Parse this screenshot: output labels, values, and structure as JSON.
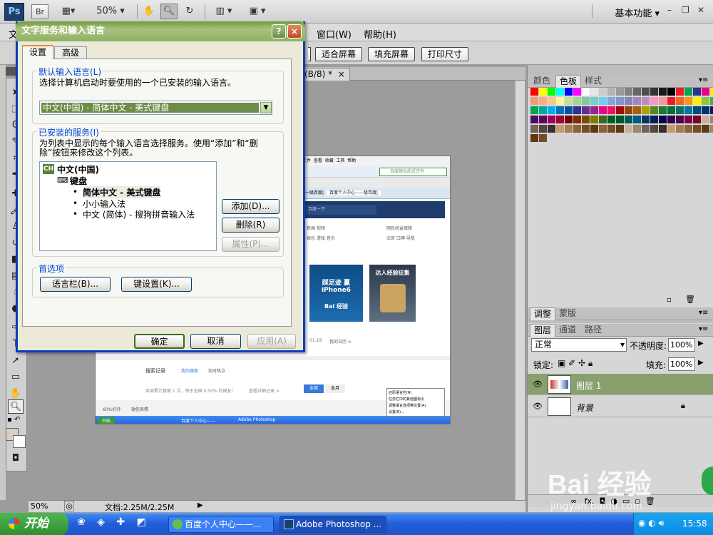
{
  "appbar": {
    "ps_logo": "Ps",
    "br_logo": "Br",
    "zoom": "50%",
    "workspace": "基本功能"
  },
  "menubar": {
    "visible_item_first": "文",
    "items": [
      "窗口(W)",
      "帮助(H)"
    ]
  },
  "options_bar": {
    "buttons": [
      "适合屏幕",
      "填充屏幕",
      "打印尺寸"
    ]
  },
  "document": {
    "tab_label": "(B/8) *",
    "tab_close": "×",
    "zoom": "50%",
    "doc_size": "文档:2.25M/2.25M"
  },
  "right_panel": {
    "color_tabs": [
      "颜色",
      "色板",
      "样式"
    ],
    "adjust_tabs": [
      "调整",
      "蒙版"
    ],
    "layer_tabs": [
      "图层",
      "通道",
      "路径"
    ],
    "blend_mode": "正常",
    "opacity_label": "不透明度:",
    "opacity_value": "100%",
    "lock_label": "锁定:",
    "fill_label": "填充:",
    "fill_value": "100%",
    "layers": [
      {
        "name": "图层 1",
        "selected": true
      },
      {
        "name": "背景",
        "selected": false
      }
    ],
    "fx": "fx."
  },
  "dialog": {
    "title": "文字服务和输入语言",
    "help_btn": "?",
    "close_btn": "×",
    "tabs": [
      "设置",
      "高级"
    ],
    "default_group_label": "默认输入语言(L)",
    "default_desc": "选择计算机启动时要使用的一个已安装的输入语言。",
    "default_value": "中文(中国) - 简体中文 - 美式键盘",
    "installed_group_label": "已安装的服务(I)",
    "installed_desc_1": "为列表中显示的每个输入语言选择服务。使用“添加”和“删",
    "installed_desc_2": "除”按钮来修改这个列表。",
    "tree": {
      "lang_badge": "CH",
      "lang": "中文(中国)",
      "keyboard": "键盘",
      "items": [
        "简体中文 - 美式键盘",
        "小小输入法",
        "中文 (简体) - 搜狗拼音输入法"
      ]
    },
    "btn_add": "添加(D)...",
    "btn_remove": "删除(R)",
    "btn_props": "属性(P)...",
    "pref_group_label": "首选项",
    "btn_langbar": "语言栏(B)...",
    "btn_keys": "键设置(K)...",
    "btn_ok": "确定",
    "btn_cancel": "取消",
    "btn_apply": "应用(A)"
  },
  "embedded_screenshot": {
    "menu": [
      "文件",
      "查看",
      "收藏",
      "工具",
      "帮助"
    ],
    "search_placeholder": "百度搜出库近还有",
    "tabs": [
      "一级百度|",
      "百度个人中心——级百度|"
    ],
    "cards": [
      "踩足迹 赢iPhone6",
      "达人经验征集"
    ],
    "baidu_text": "Bai 经验",
    "nav": [
      "新闻 视频",
      "网民权益保障",
      "娱乐 游戏 音乐",
      "法官 口碑 导航"
    ],
    "date": "01.19",
    "schedule": "我的日历 >",
    "links": [
      "搜索记录",
      "我的搜索",
      "实时热点"
    ],
    "stat": "本周累计搜索 1 次，每于全国 0.00% 的网友！",
    "stat_link": "查看详细记录 >",
    "buttons": [
      "本周",
      "本月"
    ],
    "task_items": [
      "开始",
      "百度个人中心——",
      "Adobe Photoshop"
    ],
    "context_menu": [
      "还原语言栏(R)",
      "任务栏中的其他图标(I)",
      "调整语言选项带位置(A)",
      "设置(E)..."
    ],
    "status_left": "60%好评",
    "status_mid": "微信表情"
  },
  "taskbar": {
    "start": "开始",
    "tasks": [
      "百度个人中心——...",
      "Adobe Photoshop ..."
    ],
    "clock": "15:58"
  },
  "watermark": {
    "logo": "Bai 经验",
    "url": "jingyan.baidu.com"
  }
}
